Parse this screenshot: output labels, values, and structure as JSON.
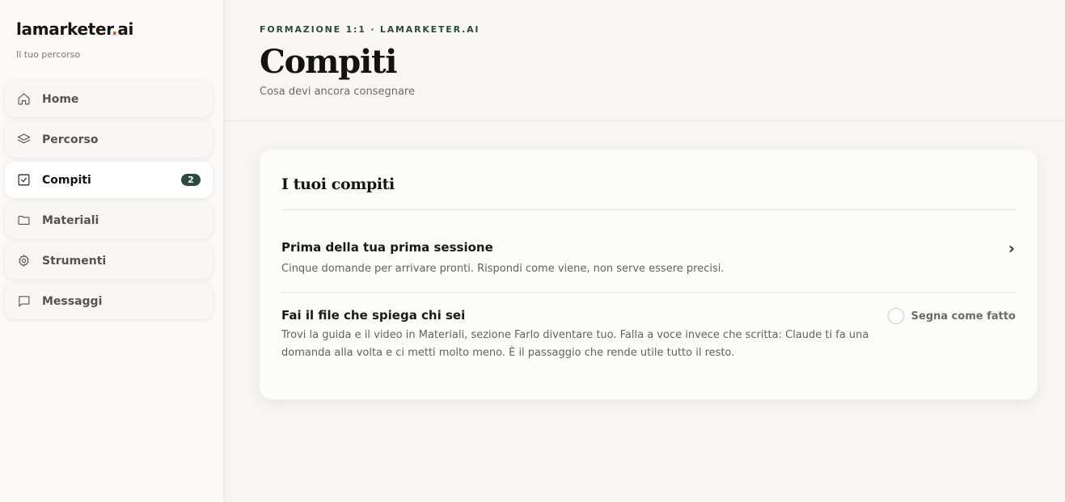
{
  "brand": {
    "name_main": "lamarketer",
    "name_dot": ".",
    "name_tld": "ai",
    "subtitle": "Il tuo percorso"
  },
  "sidebar": {
    "items": [
      {
        "label": "Home",
        "icon": "home-icon"
      },
      {
        "label": "Percorso",
        "icon": "layers-icon"
      },
      {
        "label": "Compiti",
        "icon": "checkbox-icon",
        "badge": "2",
        "active": true
      },
      {
        "label": "Materiali",
        "icon": "folder-icon"
      },
      {
        "label": "Strumenti",
        "icon": "gear-icon"
      },
      {
        "label": "Messaggi",
        "icon": "message-icon"
      }
    ]
  },
  "header": {
    "eyebrow": "FORMAZIONE 1:1 · LAMARKETER.AI",
    "title": "Compiti",
    "subtitle": "Cosa devi ancora consegnare"
  },
  "card": {
    "title": "I tuoi compiti",
    "tasks": [
      {
        "title": "Prima della tua prima sessione",
        "description": "Cinque domande per arrivare pronti. Rispondi come viene, non serve essere precisi.",
        "action": "›"
      },
      {
        "title": "Fai il file che spiega chi sei",
        "description": "Trovi la guida e il video in Materiali, sezione Farlo diventare tuo. Falla a voce invece che scritta: Claude ti fa una domanda alla volta e ci metti molto meno. È il passaggio che rende utile tutto il resto.",
        "action": "Segna come fatto"
      }
    ]
  },
  "colors": {
    "accent": "#2d4a3e",
    "brand_dot": "#d2573b",
    "background": "#f7f6f3"
  }
}
